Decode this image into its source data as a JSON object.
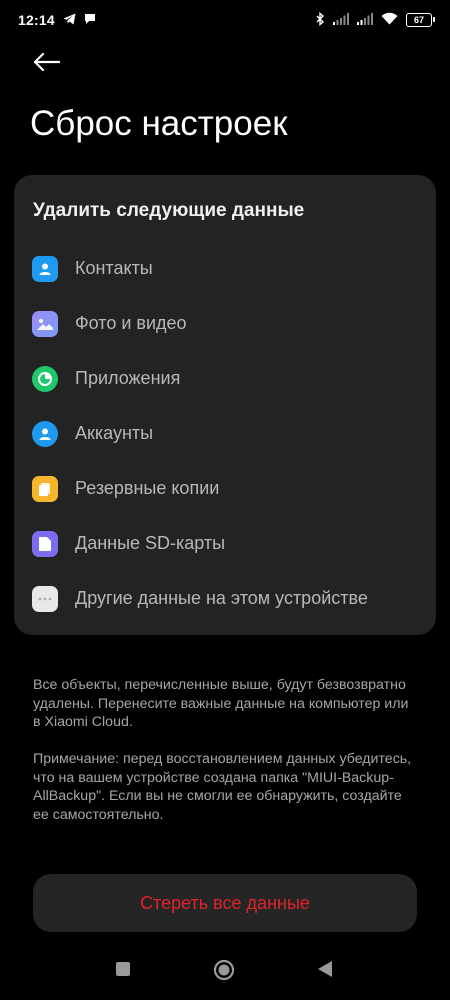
{
  "status_bar": {
    "time": "12:14",
    "battery": "67",
    "left_icons": [
      "telegram-icon",
      "message-icon"
    ],
    "right_icons": [
      "bluetooth-icon",
      "signal-icon",
      "signal-icon",
      "wifi-icon",
      "battery-icon"
    ]
  },
  "header": {
    "title": "Сброс настроек"
  },
  "card": {
    "title": "Удалить следующие данные",
    "items": [
      {
        "label": "Контакты",
        "icon": "contacts-icon",
        "color": "#1e9bf0"
      },
      {
        "label": "Фото и видео",
        "icon": "gallery-icon",
        "color": "#8c7ef0"
      },
      {
        "label": "Приложения",
        "icon": "apps-icon",
        "color": "#1fc86b"
      },
      {
        "label": "Аккаунты",
        "icon": "accounts-icon",
        "color": "#1e9bf0"
      },
      {
        "label": "Резервные копии",
        "icon": "backup-icon",
        "color": "#f5b62e"
      },
      {
        "label": "Данные SD-карты",
        "icon": "sd-card-icon",
        "color": "#7b6cf0"
      },
      {
        "label": "Другие данные на этом устройстве",
        "icon": "more-icon",
        "color": "#e8e8e8"
      }
    ]
  },
  "notes": {
    "warning": "Все объекты, перечисленные выше, будут безвозвратно удалены. Перенесите важные данные на компьютер или в Xiaomi Cloud.",
    "remark": "Примечание: перед восстановлением данных убедитесь, что на вашем устройстве создана папка \"MIUI-Backup-AllBackup\". Если вы не смогли ее обнаружить, создайте ее самостоятельно."
  },
  "actions": {
    "erase_label": "Стереть все данные",
    "erase_color": "#e0222a"
  },
  "colors": {
    "background": "#000000",
    "card": "#232323",
    "accent_red": "#e0222a"
  }
}
